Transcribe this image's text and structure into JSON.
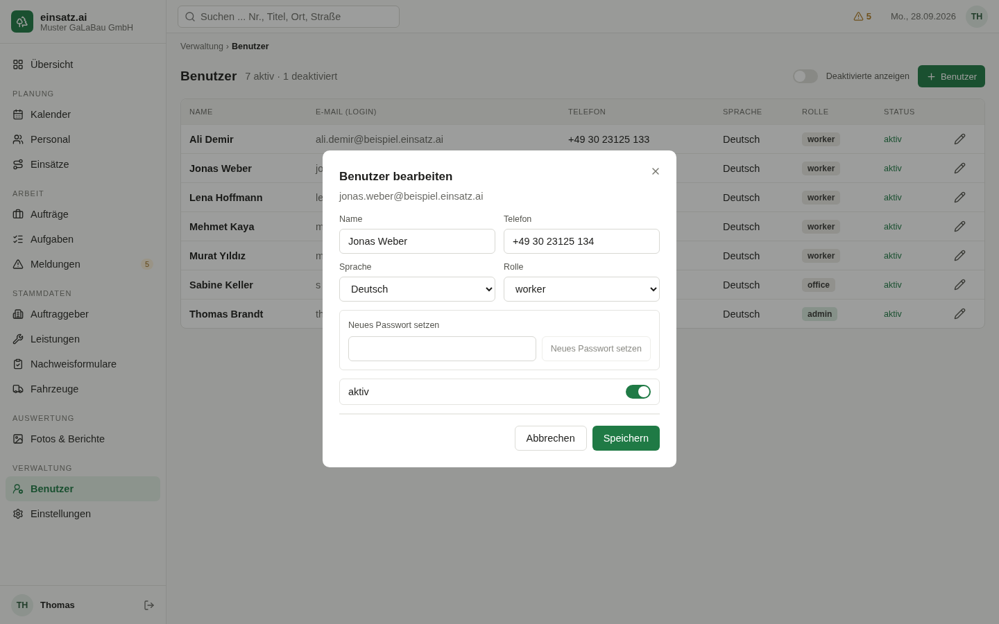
{
  "brand": {
    "name": "einsatz.ai",
    "company": "Muster GaLaBau GmbH"
  },
  "search": {
    "placeholder": "Suchen ... Nr., Titel, Ort, Straße"
  },
  "topbar": {
    "alerts": "5",
    "date": "Mo., 28.09.2026",
    "avatar": "TH"
  },
  "sidebar": {
    "sections": [
      {
        "items": [
          {
            "label": "Übersicht",
            "selected": false
          }
        ]
      },
      {
        "title": "PLANUNG",
        "items": [
          {
            "label": "Kalender",
            "selected": false
          },
          {
            "label": "Personal",
            "selected": false
          },
          {
            "label": "Einsätze",
            "selected": false
          }
        ]
      },
      {
        "title": "ARBEIT",
        "items": [
          {
            "label": "Aufträge",
            "selected": false
          },
          {
            "label": "Aufgaben",
            "selected": false
          },
          {
            "label": "Meldungen",
            "selected": false,
            "badge": "5"
          }
        ]
      },
      {
        "title": "STAMMDATEN",
        "items": [
          {
            "label": "Auftraggeber",
            "selected": false
          },
          {
            "label": "Leistungen",
            "selected": false
          },
          {
            "label": "Nachweisformulare",
            "selected": false
          },
          {
            "label": "Fahrzeuge",
            "selected": false
          }
        ]
      },
      {
        "title": "AUSWERTUNG",
        "items": [
          {
            "label": "Fotos & Berichte",
            "selected": false
          }
        ]
      },
      {
        "title": "VERWALTUNG",
        "items": [
          {
            "label": "Benutzer",
            "selected": true
          },
          {
            "label": "Einstellungen",
            "selected": false
          }
        ]
      }
    ],
    "user": {
      "initials": "TH",
      "name": "Thomas"
    }
  },
  "breadcrumb": {
    "items": [
      "Verwaltung",
      "Benutzer"
    ],
    "separator": "›"
  },
  "page": {
    "title": "Benutzer",
    "summary": "7 aktiv · 1 deaktiviert",
    "show_deactivated": {
      "label": "Deaktivierte anzeigen",
      "on": false
    },
    "add_button": "Benutzer"
  },
  "table": {
    "columns": [
      "NAME",
      "E-MAIL (LOGIN)",
      "TELEFON",
      "SPRACHE",
      "ROLLE",
      "STATUS"
    ],
    "rows": [
      {
        "name": "Ali Demir",
        "email": "ali.demir@beispiel.einsatz.ai",
        "phone": "+49 30 23125 133",
        "language": "Deutsch",
        "role": {
          "label": "worker",
          "color": "#91918e"
        },
        "status": "aktiv"
      },
      {
        "name": "Jonas Weber",
        "email": "jo",
        "language": "Deutsch",
        "role": {
          "label": "worker",
          "color": "#91918e"
        },
        "status": "aktiv"
      },
      {
        "name": "Lena Hoffmann",
        "email": "le",
        "language": "Deutsch",
        "role": {
          "label": "worker",
          "color": "#91918e"
        },
        "status": "aktiv"
      },
      {
        "name": "Mehmet Kaya",
        "email": "m",
        "language": "Deutsch",
        "role": {
          "label": "worker",
          "color": "#91918e"
        },
        "status": "aktiv"
      },
      {
        "name": "Murat Yıldız",
        "email": "m",
        "language": "Deutsch",
        "role": {
          "label": "worker",
          "color": "#91918e"
        },
        "status": "aktiv"
      },
      {
        "name": "Sabine Keller",
        "email": "s",
        "language": "Deutsch",
        "role": {
          "label": "office",
          "color": "#91918e"
        },
        "status": "aktiv"
      },
      {
        "name": "Thomas Brandt",
        "email": "th",
        "language": "Deutsch",
        "role": {
          "label": "admin",
          "color": "#86918a"
        },
        "status": "aktiv"
      }
    ]
  },
  "dialog": {
    "title": "Benutzer bearbeiten",
    "subtitle": "jonas.weber@beispiel.einsatz.ai",
    "name": {
      "label": "Name",
      "value": "Jonas Weber"
    },
    "phone": {
      "label": "Telefon",
      "value": "+49 30 23125 134"
    },
    "language": {
      "label": "Sprache",
      "value": "Deutsch"
    },
    "role": {
      "label": "Rolle",
      "value": "worker"
    },
    "password": {
      "label": "Neues Passwort setzen",
      "button": "Neues Passwort setzen"
    },
    "active": {
      "label": "aktiv",
      "on": true
    },
    "cancel": "Abbrechen",
    "save": "Speichern"
  }
}
